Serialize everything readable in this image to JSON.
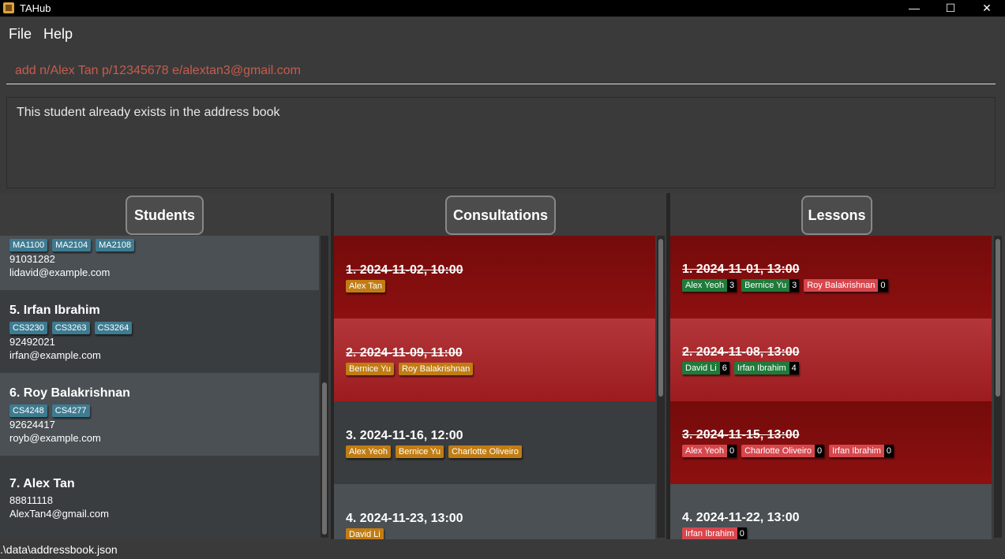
{
  "window": {
    "title": "TAHub",
    "minimize": "—",
    "maximize": "☐",
    "close": "✕"
  },
  "menu": {
    "file": "File",
    "help": "Help"
  },
  "command": {
    "value": "add n/Alex Tan p/12345678 e/alextan3@gmail.com"
  },
  "result": {
    "text": "This student already exists in the address book"
  },
  "panels": {
    "students": "Students",
    "consultations": "Consultations",
    "lessons": "Lessons"
  },
  "students": [
    {
      "name": "",
      "modules": [
        "MA1100",
        "MA2104",
        "MA2108"
      ],
      "phone": "91031282",
      "email": "lidavid@example.com"
    },
    {
      "name": "5. Irfan Ibrahim",
      "modules": [
        "CS3230",
        "CS3263",
        "CS3264"
      ],
      "phone": "92492021",
      "email": "irfan@example.com"
    },
    {
      "name": "6. Roy Balakrishnan",
      "modules": [
        "CS4248",
        "CS4277"
      ],
      "phone": "92624417",
      "email": "royb@example.com"
    },
    {
      "name": "7. Alex Tan",
      "modules": [],
      "phone": "88811118",
      "email": "AlexTan4@gmail.com"
    }
  ],
  "consultations": [
    {
      "title": "1. 2024-11-02, 10:00",
      "past": true,
      "students": [
        "Alex Tan"
      ]
    },
    {
      "title": "2. 2024-11-09, 11:00",
      "past": true,
      "students": [
        "Bernice Yu",
        "Roy Balakrishnan"
      ]
    },
    {
      "title": "3. 2024-11-16, 12:00",
      "past": false,
      "students": [
        "Alex Yeoh",
        "Bernice Yu",
        "Charlotte Oliveiro"
      ]
    },
    {
      "title": "4. 2024-11-23, 13:00",
      "past": false,
      "students": [
        "David Li"
      ]
    }
  ],
  "lessons": [
    {
      "title": "1. 2024-11-01, 13:00",
      "past": true,
      "attendance": [
        {
          "name": "Alex Yeoh",
          "count": "3",
          "present": true
        },
        {
          "name": "Bernice Yu",
          "count": "3",
          "present": true
        },
        {
          "name": "Roy Balakrishnan",
          "count": "0",
          "present": false
        }
      ]
    },
    {
      "title": "2. 2024-11-08, 13:00",
      "past": true,
      "attendance": [
        {
          "name": "David Li",
          "count": "6",
          "present": true
        },
        {
          "name": "Irfan Ibrahim",
          "count": "4",
          "present": true
        }
      ]
    },
    {
      "title": "3. 2024-11-15, 13:00",
      "past": true,
      "attendance": [
        {
          "name": "Alex Yeoh",
          "count": "0",
          "present": false
        },
        {
          "name": "Charlotte Oliveiro",
          "count": "0",
          "present": false
        },
        {
          "name": "Irfan Ibrahim",
          "count": "0",
          "present": false
        }
      ]
    },
    {
      "title": "4. 2024-11-22, 13:00",
      "past": false,
      "attendance": [
        {
          "name": "Irfan Ibrahim",
          "count": "0",
          "present": false
        }
      ]
    }
  ],
  "status": {
    "path": ".\\data\\addressbook.json"
  },
  "colors": {
    "module_tag": "#3e7b91",
    "student_tag": "#c17d14",
    "present": "#1f7b3a",
    "absent": "#d6474d",
    "past_card": "#8d1010"
  }
}
